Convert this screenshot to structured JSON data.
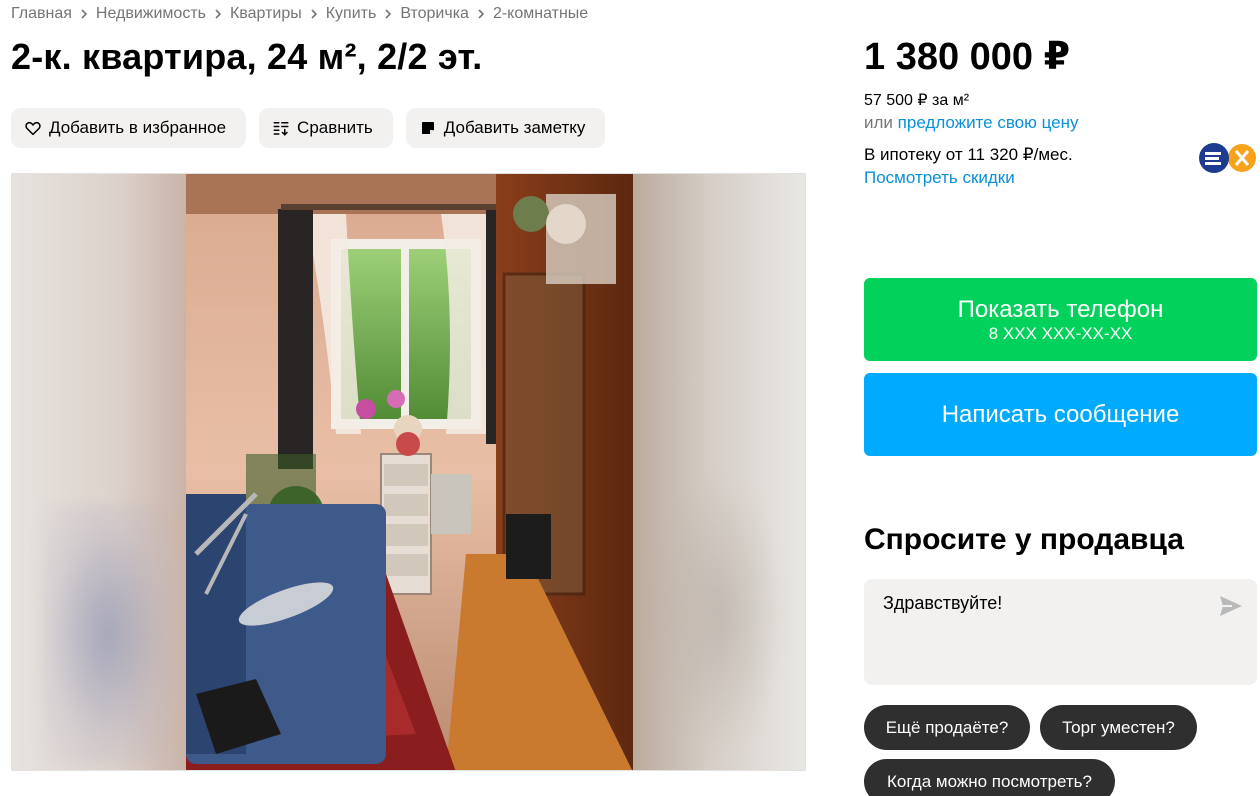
{
  "breadcrumb": [
    "Главная",
    "Недвижимость",
    "Квартиры",
    "Купить",
    "Вторичка",
    "2-комнатные"
  ],
  "title": "2-к. квартира, 24 м², 2/2 эт.",
  "actions": {
    "favorite": "Добавить в избранное",
    "compare": "Сравнить",
    "note": "Добавить заметку"
  },
  "price": {
    "total": "1 380 000 ₽",
    "per_m2": "57 500 ₽ за м²",
    "offer_prefix": "или",
    "offer_link": "предложите свою цену",
    "mortgage": "В ипотеку от 11 320 ₽/мес.",
    "discounts_link": "Посмотреть скидки"
  },
  "contact": {
    "show_phone": "Показать телефон",
    "phone_mask": "8 XXX XXX-XX-XX",
    "write_message": "Написать сообщение"
  },
  "ask": {
    "title": "Спросите у продавца",
    "message": "Здравствуйте!",
    "quick_questions": [
      "Ещё продаёте?",
      "Торг уместен?",
      "Когда можно посмотреть?"
    ]
  },
  "icons": {
    "favorite": "heart-icon",
    "compare": "compare-icon",
    "note": "note-icon",
    "send": "send-icon",
    "breadcrumb_separator": "chevron-right-icon"
  },
  "colors": {
    "green": "#02d15c",
    "blue": "#00aaff",
    "link": "#0a8fdb",
    "chip": "#2f2f2f",
    "chip_bg": "#f2f1f0"
  }
}
